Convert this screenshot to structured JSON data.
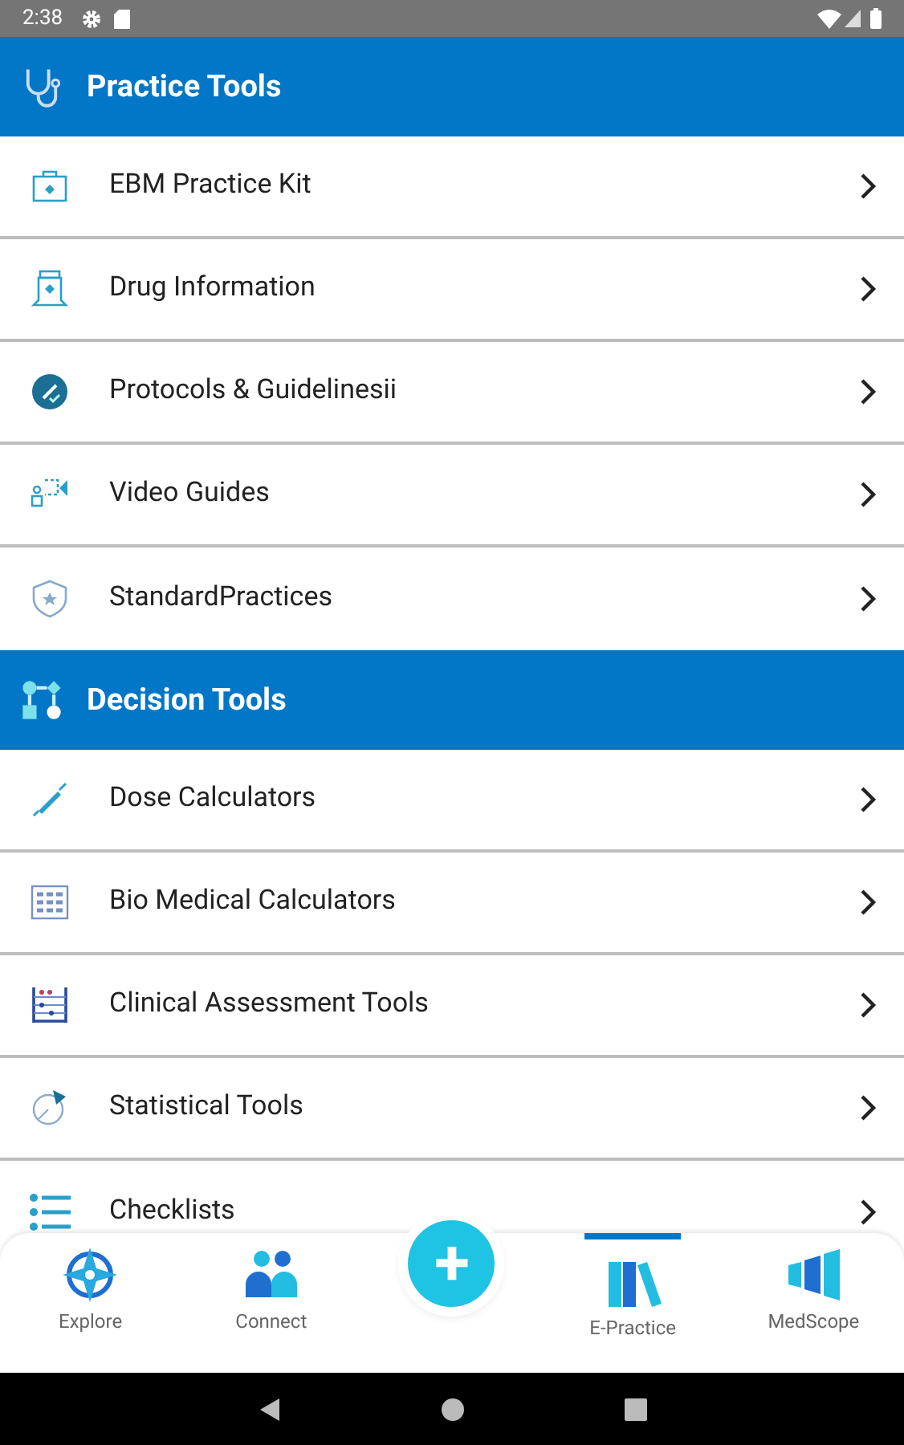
{
  "status_bar": {
    "time": "2:38"
  },
  "sections": [
    {
      "title": "Practice Tools",
      "items": [
        {
          "label": "EBM Practice Kit"
        },
        {
          "label": "Drug Information"
        },
        {
          "label": "Protocols & Guidelinesii"
        },
        {
          "label": "Video Guides"
        },
        {
          "label": "StandardPractices"
        }
      ]
    },
    {
      "title": "Decision Tools",
      "items": [
        {
          "label": "Dose Calculators"
        },
        {
          "label": "Bio Medical Calculators"
        },
        {
          "label": "Clinical Assessment Tools"
        },
        {
          "label": "Statistical Tools"
        },
        {
          "label": "Checklists"
        }
      ]
    }
  ],
  "fab": {
    "label": "+"
  },
  "bottom_nav": [
    {
      "label": "Explore",
      "selected": false
    },
    {
      "label": "Connect",
      "selected": false
    },
    {
      "label": "E-Practice",
      "selected": true
    },
    {
      "label": "MedScope",
      "selected": false
    }
  ]
}
